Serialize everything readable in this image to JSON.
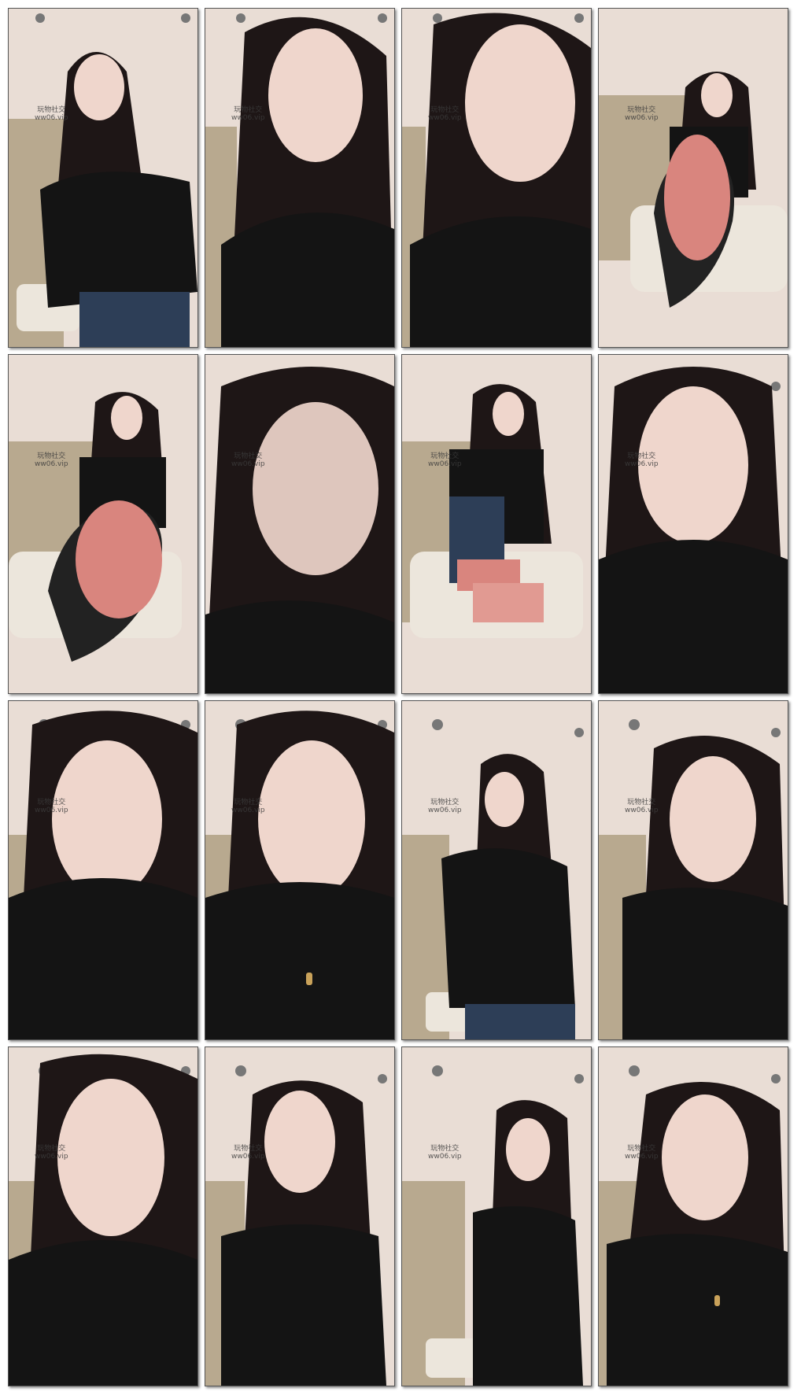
{
  "image": {
    "kind": "contact-sheet",
    "rows": 4,
    "columns": 4,
    "frame_count": 16
  },
  "watermark": {
    "line1": "玩物社交",
    "line2": "ww06.vip"
  },
  "colors": {
    "wall": "#e9ddd5",
    "curtain": "#b8a98f",
    "sweater": "#141414",
    "hair": "#1e1616",
    "skin": "#efd6cc",
    "sole": "#d9857e",
    "cushion": "#ece6dc"
  },
  "frames": [
    {
      "index": 1,
      "scene": "woman-arms-crossed",
      "has_watermark": true
    },
    {
      "index": 2,
      "scene": "face-close-up",
      "has_watermark": true
    },
    {
      "index": 3,
      "scene": "face-close-up",
      "has_watermark": true
    },
    {
      "index": 4,
      "scene": "foot-raised",
      "has_watermark": true
    },
    {
      "index": 5,
      "scene": "foot-raised",
      "has_watermark": true
    },
    {
      "index": 6,
      "scene": "face-close-up-blurred",
      "has_watermark": true
    },
    {
      "index": 7,
      "scene": "foot-raised-pixelated",
      "has_watermark": true
    },
    {
      "index": 8,
      "scene": "face-close-up",
      "has_watermark": true
    },
    {
      "index": 9,
      "scene": "face-close-up",
      "has_watermark": true
    },
    {
      "index": 10,
      "scene": "face-close-up-necklace",
      "has_watermark": true
    },
    {
      "index": 11,
      "scene": "woman-standing-hair-touch",
      "has_watermark": true
    },
    {
      "index": 12,
      "scene": "face-close-up",
      "has_watermark": true
    },
    {
      "index": 13,
      "scene": "face-close-up",
      "has_watermark": true
    },
    {
      "index": 14,
      "scene": "face-pout",
      "has_watermark": true
    },
    {
      "index": 15,
      "scene": "woman-smiling-hand-chin",
      "has_watermark": true
    },
    {
      "index": 16,
      "scene": "face-close-up-necklace",
      "has_watermark": true
    }
  ]
}
